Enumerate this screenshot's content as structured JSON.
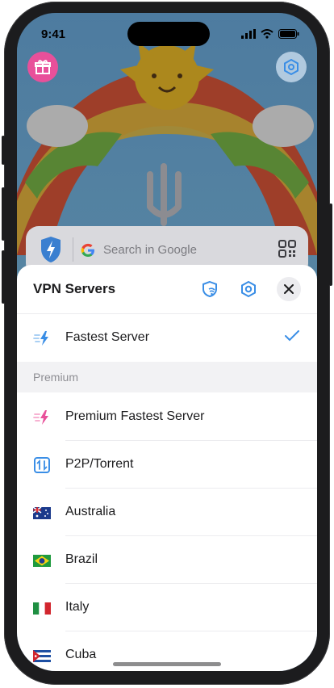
{
  "status_bar": {
    "time": "9:41"
  },
  "search": {
    "placeholder": "Search in Google"
  },
  "sheet": {
    "title": "VPN Servers",
    "rows": [
      {
        "label": "Fastest Server",
        "selected": true,
        "icon": "lightning-blue-icon"
      },
      {
        "label": "Premium Fastest Server",
        "icon": "lightning-pink-icon"
      },
      {
        "label": "P2P/Torrent",
        "icon": "p2p-torrent-icon"
      },
      {
        "label": "Australia",
        "icon": "australia-flag-icon"
      },
      {
        "label": "Brazil",
        "icon": "brazil-flag-icon"
      },
      {
        "label": "Italy",
        "icon": "italy-flag-icon"
      },
      {
        "label": "Cuba",
        "icon": "cuba-flag-icon"
      }
    ],
    "section_label": "Premium"
  },
  "colors": {
    "accent": "#3a8ee6",
    "pink": "#e8509a",
    "gift_bg": "#e8509a"
  }
}
